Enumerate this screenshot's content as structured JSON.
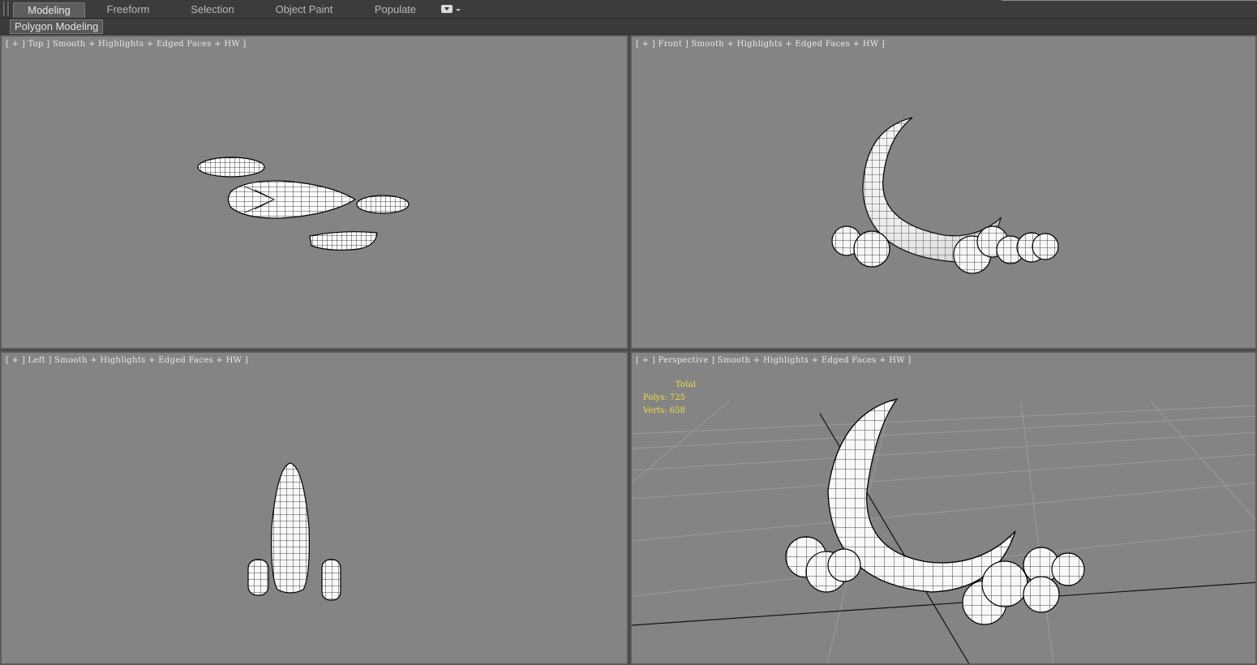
{
  "ribbon": {
    "tabs": [
      {
        "label": "Modeling",
        "active": true
      },
      {
        "label": "Freeform",
        "active": false
      },
      {
        "label": "Selection",
        "active": false
      },
      {
        "label": "Object Paint",
        "active": false
      },
      {
        "label": "Populate",
        "active": false
      }
    ],
    "panel_label": "Polygon Modeling"
  },
  "viewports": {
    "top": {
      "label": "[ + ] Top ] Smooth + Highlights + Edged Faces + HW ]"
    },
    "front": {
      "label": "[ + ] Front ] Smooth + Highlights + Edged Faces + HW ]"
    },
    "left": {
      "label": "[ + ] Left ] Smooth + Highlights + Edged Faces + HW ]"
    },
    "perspective": {
      "label": "[ + ] Perspective ] Smooth + Highlights + Edged Faces + HW ]"
    }
  },
  "stats": {
    "title": "Total",
    "polys_label": "Polys:",
    "polys": "725",
    "verts_label": "Verts:",
    "verts": "658"
  },
  "colors": {
    "viewport_bg": "#848484",
    "stats_text": "#f2df3c",
    "mesh_fill": "#ffffff",
    "mesh_wire": "#000000"
  },
  "icons": [
    "ribbon-menu-icon",
    "dropdown-arrow-icon"
  ]
}
